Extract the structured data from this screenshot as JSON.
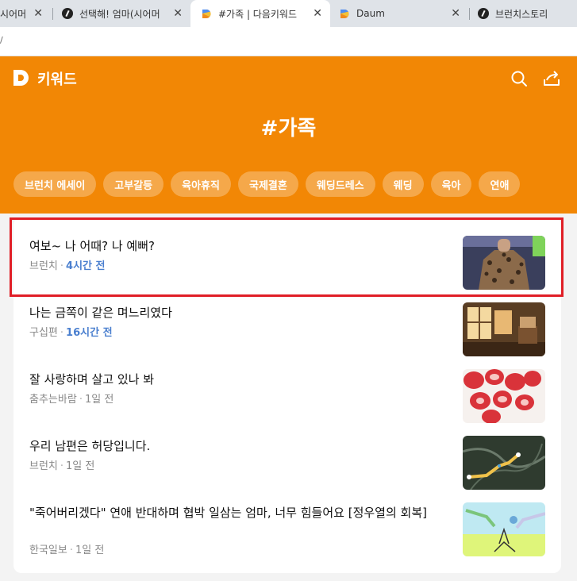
{
  "browser": {
    "tabs": [
      {
        "title": "시어머",
        "favicon": "brunch-icon",
        "active": false
      },
      {
        "title": "선택해! 엄마(시어머",
        "favicon": "brunch-icon",
        "active": false
      },
      {
        "title": "#가족 | 다음키워드",
        "favicon": "daum-icon",
        "active": true
      },
      {
        "title": "Daum",
        "favicon": "daum-icon",
        "active": false
      },
      {
        "title": "브런치스토리",
        "favicon": "brunch-icon",
        "active": false
      }
    ],
    "address_fragment": "/"
  },
  "header": {
    "logo_letter": "D",
    "service_name": "키워드",
    "keyword": "#가족",
    "chips": [
      "브런치 에세이",
      "고부갈등",
      "육아휴직",
      "국제결혼",
      "웨딩드레스",
      "웨딩",
      "육아",
      "연애"
    ],
    "colors": {
      "background": "#f28705",
      "text": "#ffffff"
    }
  },
  "articles": [
    {
      "headline": "여보~ 나 어때? 나 예뻐?",
      "source": "브런치",
      "time": "4시간 전",
      "recent": true,
      "thumb": "leopard-shirt-photo"
    },
    {
      "headline": "나는 금쪽이 같은 며느리였다",
      "source": "구십편",
      "time": "16시간 전",
      "recent": true,
      "thumb": "sunlit-room-photo"
    },
    {
      "headline": "잘 사랑하며 살고 있나 봐",
      "source": "춤추는바람",
      "time": "1일 전",
      "recent": false,
      "thumb": "strawberries-photo"
    },
    {
      "headline": "우리 남편은 허당입니다.",
      "source": "브런치",
      "time": "1일 전",
      "recent": false,
      "thumb": "map-route-image"
    },
    {
      "headline": "\"죽어버리겠다\" 연애 반대하며 협박 일삼는 엄마, 너무 힘들어요 [정우열의 회복]",
      "source": "한국일보",
      "time": "1일 전",
      "recent": false,
      "thumb": "illustration-image"
    }
  ],
  "highlight": {
    "color": "#e01e26",
    "target_article": 0
  }
}
